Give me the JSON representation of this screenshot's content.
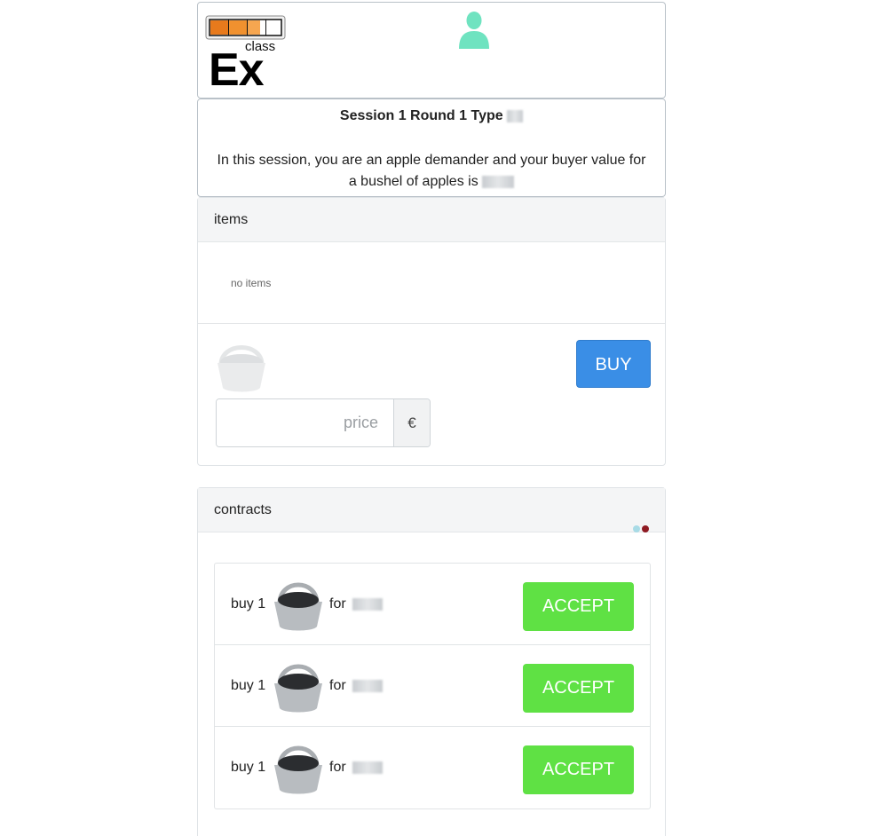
{
  "header": {
    "logo_top": "class",
    "logo_main": "Ex",
    "user_icon": "user-icon"
  },
  "info": {
    "title": "Session 1 Round 1 Type",
    "description_line1": "In this session, you are an apple demander and your buyer value for",
    "description_line2": "a bushel of apples is"
  },
  "items": {
    "heading": "items",
    "empty_text": "no items",
    "buy_label": "BUY",
    "price_placeholder": "price",
    "currency": "€"
  },
  "contracts": {
    "heading": "contracts",
    "rows": [
      {
        "prefix": "buy 1",
        "for": "for",
        "accept_label": "ACCEPT"
      },
      {
        "prefix": "buy 1",
        "for": "for",
        "accept_label": "ACCEPT"
      },
      {
        "prefix": "buy 1",
        "for": "for",
        "accept_label": "ACCEPT"
      }
    ]
  },
  "colors": {
    "buy": "#3a8ee6",
    "accept": "#5fe144",
    "user_icon": "#6fe3c0"
  }
}
